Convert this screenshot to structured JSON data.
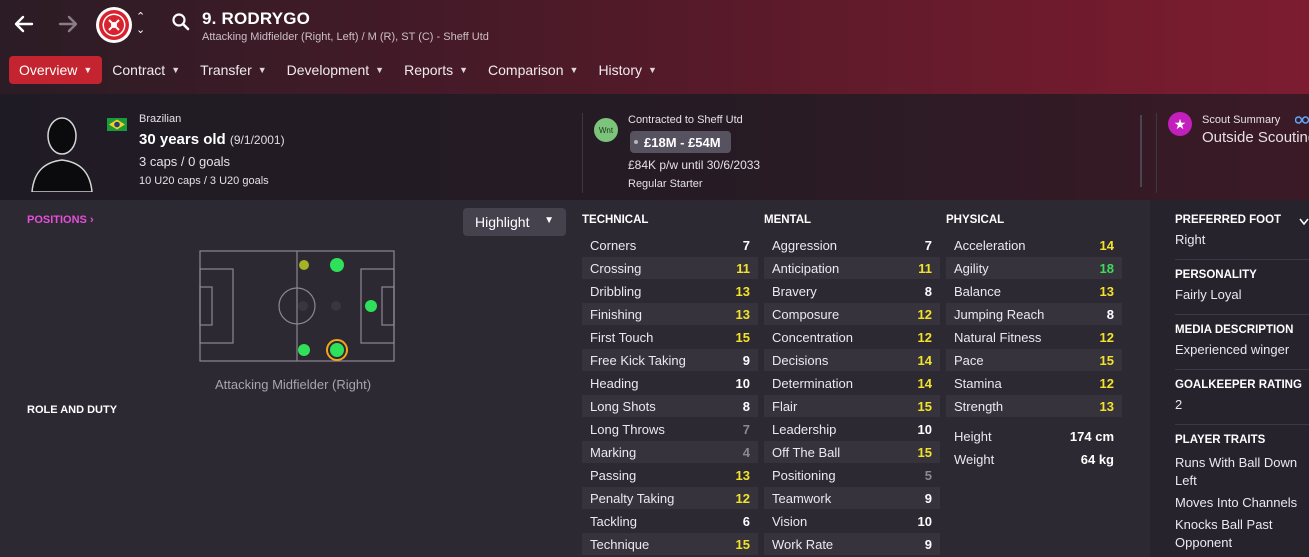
{
  "header": {
    "player_name": "9. RODRYGO",
    "player_subtitle": "Attacking Midfielder (Right, Left) / M (R), ST (C) - Sheff Utd"
  },
  "tabs": [
    {
      "label": "Overview",
      "active": true
    },
    {
      "label": "Contract"
    },
    {
      "label": "Transfer"
    },
    {
      "label": "Development"
    },
    {
      "label": "Reports"
    },
    {
      "label": "Comparison"
    },
    {
      "label": "History"
    }
  ],
  "bio": {
    "nationality": "Brazilian",
    "age": "30 years old",
    "dob": "(9/1/2001)",
    "caps": "3 caps / 0 goals",
    "u20": "10 U20 caps / 3 U20 goals"
  },
  "contract": {
    "badge": "Wnt",
    "title": "Contracted to Sheff Utd",
    "value_range": "£18M - £54M",
    "wage": "£84K p/w until 30/6/2033",
    "status": "Regular Starter"
  },
  "scout": {
    "title": "Scout Summary",
    "value": "Outside Scouting"
  },
  "positions": {
    "label": "POSITIONS",
    "highlight_button": "Highlight",
    "caption": "Attacking Midfielder (Right)",
    "role_label": "ROLE AND DUTY"
  },
  "technical": {
    "title": "TECHNICAL",
    "rows": [
      {
        "name": "Corners",
        "value": "7",
        "tier": "white"
      },
      {
        "name": "Crossing",
        "value": "11",
        "tier": "yellow"
      },
      {
        "name": "Dribbling",
        "value": "13",
        "tier": "yellow"
      },
      {
        "name": "Finishing",
        "value": "13",
        "tier": "yellow"
      },
      {
        "name": "First Touch",
        "value": "15",
        "tier": "yellow"
      },
      {
        "name": "Free Kick Taking",
        "value": "9",
        "tier": "white"
      },
      {
        "name": "Heading",
        "value": "10",
        "tier": "white"
      },
      {
        "name": "Long Shots",
        "value": "8",
        "tier": "white"
      },
      {
        "name": "Long Throws",
        "value": "7",
        "tier": "gray"
      },
      {
        "name": "Marking",
        "value": "4",
        "tier": "gray"
      },
      {
        "name": "Passing",
        "value": "13",
        "tier": "yellow"
      },
      {
        "name": "Penalty Taking",
        "value": "12",
        "tier": "yellow"
      },
      {
        "name": "Tackling",
        "value": "6",
        "tier": "white"
      },
      {
        "name": "Technique",
        "value": "15",
        "tier": "yellow"
      }
    ]
  },
  "mental": {
    "title": "MENTAL",
    "rows": [
      {
        "name": "Aggression",
        "value": "7",
        "tier": "white"
      },
      {
        "name": "Anticipation",
        "value": "11",
        "tier": "yellow"
      },
      {
        "name": "Bravery",
        "value": "8",
        "tier": "white"
      },
      {
        "name": "Composure",
        "value": "12",
        "tier": "yellow"
      },
      {
        "name": "Concentration",
        "value": "12",
        "tier": "yellow"
      },
      {
        "name": "Decisions",
        "value": "14",
        "tier": "yellow"
      },
      {
        "name": "Determination",
        "value": "14",
        "tier": "yellow"
      },
      {
        "name": "Flair",
        "value": "15",
        "tier": "yellow"
      },
      {
        "name": "Leadership",
        "value": "10",
        "tier": "white"
      },
      {
        "name": "Off The Ball",
        "value": "15",
        "tier": "yellow"
      },
      {
        "name": "Positioning",
        "value": "5",
        "tier": "gray"
      },
      {
        "name": "Teamwork",
        "value": "9",
        "tier": "white"
      },
      {
        "name": "Vision",
        "value": "10",
        "tier": "white"
      },
      {
        "name": "Work Rate",
        "value": "9",
        "tier": "white"
      }
    ]
  },
  "physical": {
    "title": "PHYSICAL",
    "rows": [
      {
        "name": "Acceleration",
        "value": "14",
        "tier": "yellow"
      },
      {
        "name": "Agility",
        "value": "18",
        "tier": "green"
      },
      {
        "name": "Balance",
        "value": "13",
        "tier": "yellow"
      },
      {
        "name": "Jumping Reach",
        "value": "8",
        "tier": "white"
      },
      {
        "name": "Natural Fitness",
        "value": "12",
        "tier": "yellow"
      },
      {
        "name": "Pace",
        "value": "15",
        "tier": "yellow"
      },
      {
        "name": "Stamina",
        "value": "12",
        "tier": "yellow"
      },
      {
        "name": "Strength",
        "value": "13",
        "tier": "yellow"
      }
    ],
    "height_label": "Height",
    "height_value": "174 cm",
    "weight_label": "Weight",
    "weight_value": "64 kg"
  },
  "side": {
    "preferred_foot_title": "PREFERRED FOOT",
    "preferred_foot": "Right",
    "personality_title": "PERSONALITY",
    "personality": "Fairly Loyal",
    "media_title": "MEDIA DESCRIPTION",
    "media": "Experienced winger",
    "gk_title": "GOALKEEPER RATING",
    "gk": "2",
    "traits_title": "PLAYER TRAITS",
    "trait1a": "Runs With Ball Down",
    "trait1b": "Left",
    "trait2": "Moves Into Channels",
    "trait3a": "Knocks Ball Past",
    "trait3b": "Opponent"
  },
  "colors": {
    "accent_red": "#c4242f",
    "attr_yellow": "#f2e32a",
    "attr_green": "#3fdc5b",
    "positions_pink": "#e54fd9"
  }
}
